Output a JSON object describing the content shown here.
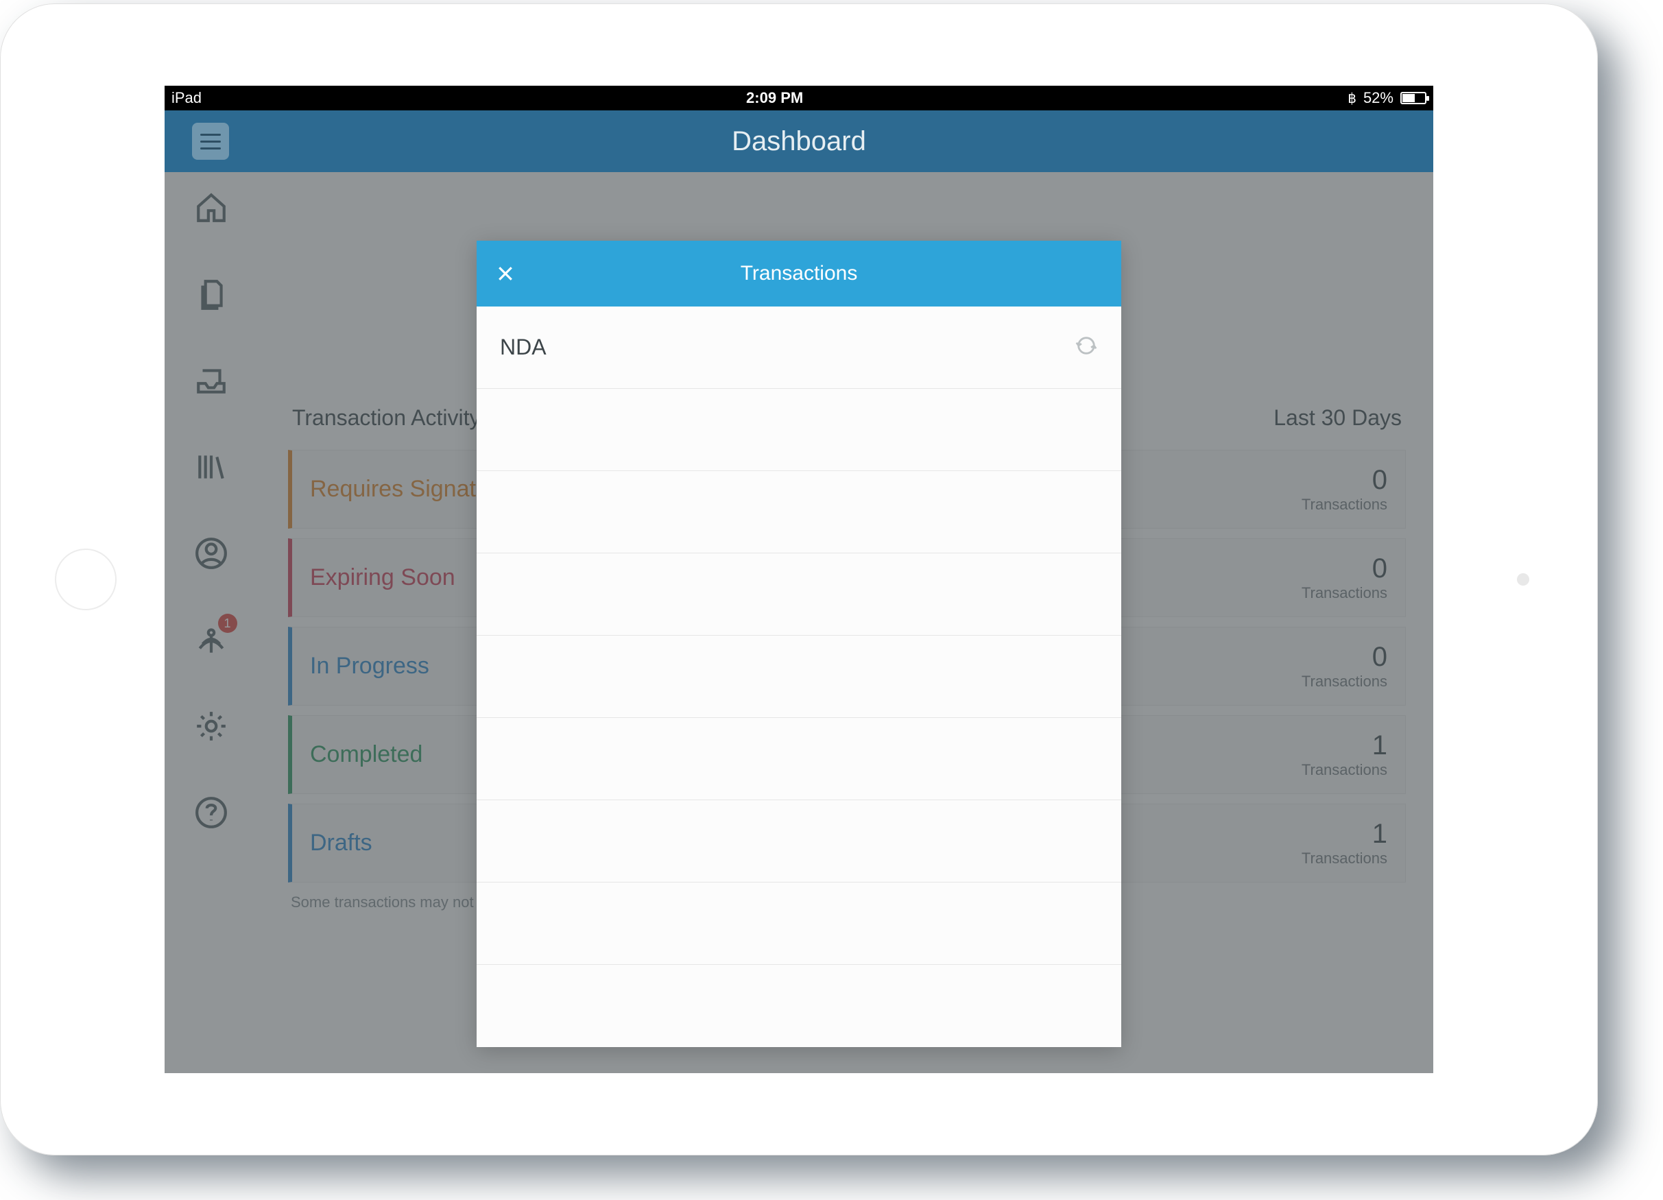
{
  "status": {
    "carrier": "iPad",
    "time": "2:09 PM",
    "battery_pct": "52%"
  },
  "header": {
    "title": "Dashboard"
  },
  "sidebar": {
    "notification_badge": "1"
  },
  "activity": {
    "heading": "Transaction Activity",
    "filter": "Last 30 Days",
    "sub_label": "Transactions",
    "rows": [
      {
        "label": "Requires Signature",
        "count": "0"
      },
      {
        "label": "Expiring Soon",
        "count": "0"
      },
      {
        "label": "In Progress",
        "count": "0"
      },
      {
        "label": "Completed",
        "count": "1"
      },
      {
        "label": "Drafts",
        "count": "1"
      }
    ],
    "footnote": "Some transactions may not be synchronized"
  },
  "modal": {
    "title": "Transactions",
    "rows": [
      "NDA"
    ]
  }
}
